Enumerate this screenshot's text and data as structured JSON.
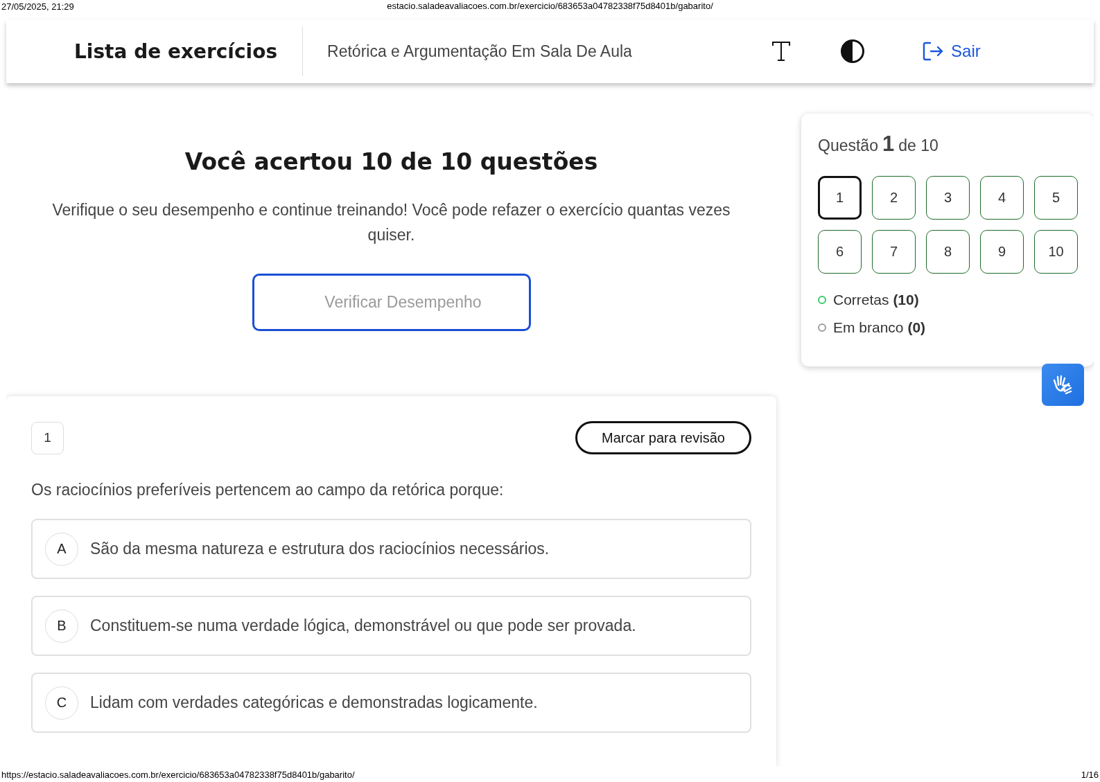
{
  "print_header": {
    "date": "27/05/2025, 21:29",
    "url": "estacio.saladeavaliacoes.com.br/exercicio/683653a04782338f75d8401b/gabarito/"
  },
  "header": {
    "title": "Lista de exercícios",
    "subject": "Retórica e Argumentação Em Sala De Aula",
    "logout": "Sair"
  },
  "result": {
    "title": "Você acertou 10 de 10 questões",
    "message": "Verifique o seu desempenho e continue treinando! Você pode refazer o exercício quantas vezes quiser.",
    "button": "Verificar Desempenho"
  },
  "navigator": {
    "label_before": "Questão",
    "current": "1",
    "label_after": "de 10",
    "questions": [
      {
        "number": "1",
        "selected": true
      },
      {
        "number": "2",
        "selected": false
      },
      {
        "number": "3",
        "selected": false
      },
      {
        "number": "4",
        "selected": false
      },
      {
        "number": "5",
        "selected": false
      },
      {
        "number": "6",
        "selected": false
      },
      {
        "number": "7",
        "selected": false
      },
      {
        "number": "8",
        "selected": false
      },
      {
        "number": "9",
        "selected": false
      },
      {
        "number": "10",
        "selected": false
      }
    ],
    "legend": [
      {
        "label": "Corretas",
        "count": "(10)",
        "color": "#3cc96a"
      },
      {
        "label": "Em branco",
        "count": "(0)",
        "color": "#9e9e9e"
      }
    ]
  },
  "question": {
    "number": "1",
    "review_button": "Marcar para revisão",
    "statement": "Os raciocínios preferíveis pertencem ao campo da retórica porque:",
    "options": [
      {
        "letter": "A",
        "text": "São da mesma natureza e estrutura dos raciocínios necessários."
      },
      {
        "letter": "B",
        "text": "Constituem-se numa verdade lógica, demonstrável ou que pode ser provada."
      },
      {
        "letter": "C",
        "text": "Lidam com verdades categóricas e demonstradas logicamente."
      }
    ]
  },
  "print_footer": {
    "url": "https://estacio.saladeavaliacoes.com.br/exercicio/683653a04782338f75d8401b/gabarito/",
    "page": "1/16"
  }
}
